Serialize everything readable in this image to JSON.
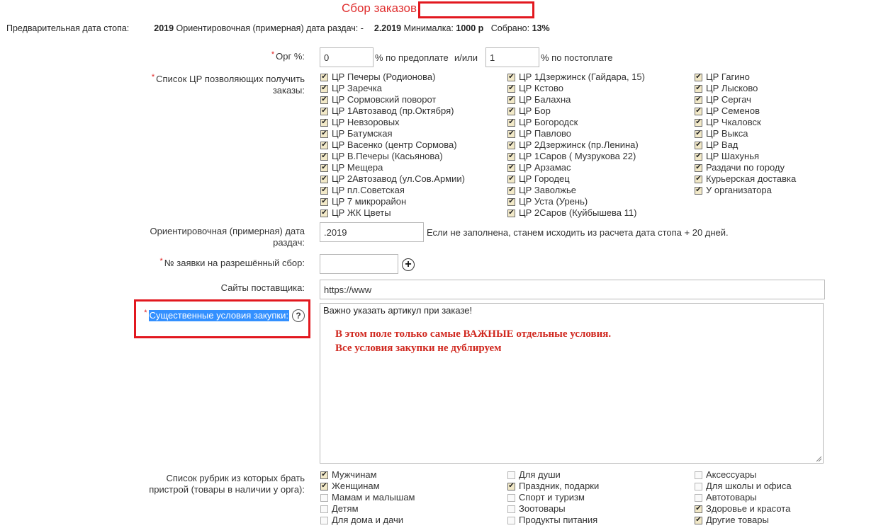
{
  "header": {
    "title": "Сбор заказов"
  },
  "summary": {
    "stop_label": "Предварительная дата стопа:",
    "stop_value": "2019",
    "dist_label": "Ориентировочная (примерная) дата раздач:",
    "dist_sep": "-",
    "dist_value": "2.2019",
    "min_label": "Минималка:",
    "min_value": "1000 р",
    "collected_label": "Собрано:",
    "collected_value": "13%"
  },
  "org": {
    "label": "Орг %:",
    "prepay_value": "0",
    "prepay_suffix": "% по предоплате",
    "or": "и/или",
    "postpay_value": "1",
    "postpay_suffix": "% по постоплате"
  },
  "centers": {
    "label": "Список ЦР позволяющих получить заказы:",
    "col1": [
      {
        "label": "ЦР Печеры (Родионова)",
        "checked": true
      },
      {
        "label": "ЦР Заречка",
        "checked": true
      },
      {
        "label": "ЦР Сормовский поворот",
        "checked": true
      },
      {
        "label": "ЦР 1Автозавод (пр.Октября)",
        "checked": true
      },
      {
        "label": "ЦР Невзоровых",
        "checked": true
      },
      {
        "label": "ЦР Батумская",
        "checked": true
      },
      {
        "label": "ЦР Васенко (центр Сормова)",
        "checked": true
      },
      {
        "label": "ЦР В.Печеры (Касьянова)",
        "checked": true
      },
      {
        "label": "ЦР Мещера",
        "checked": true
      },
      {
        "label": "ЦР 2Автозавод (ул.Сов.Армии)",
        "checked": true
      },
      {
        "label": "ЦР пл.Советская",
        "checked": true
      },
      {
        "label": "ЦР 7 микрорайон",
        "checked": true
      },
      {
        "label": "ЦР ЖК Цветы",
        "checked": true
      }
    ],
    "col2": [
      {
        "label": "ЦР 1Дзержинск (Гайдара, 15)",
        "checked": true
      },
      {
        "label": "ЦР Кстово",
        "checked": true
      },
      {
        "label": "ЦР Балахна",
        "checked": true
      },
      {
        "label": "ЦР Бор",
        "checked": true
      },
      {
        "label": "ЦР Богородск",
        "checked": true
      },
      {
        "label": "ЦР Павлово",
        "checked": true
      },
      {
        "label": "ЦР 2Дзержинск (пр.Ленина)",
        "checked": true
      },
      {
        "label": "ЦР 1Саров ( Музрукова 22)",
        "checked": true
      },
      {
        "label": "ЦР Арзамас",
        "checked": true
      },
      {
        "label": "ЦР Городец",
        "checked": true
      },
      {
        "label": "ЦР Заволжье",
        "checked": true
      },
      {
        "label": "ЦР Уста (Урень)",
        "checked": true
      },
      {
        "label": "ЦР 2Саров (Куйбышева 11)",
        "checked": true
      }
    ],
    "col3": [
      {
        "label": "ЦР Гагино",
        "checked": true
      },
      {
        "label": "ЦР Лысково",
        "checked": true
      },
      {
        "label": "ЦР Сергач",
        "checked": true
      },
      {
        "label": "ЦР Семенов",
        "checked": true
      },
      {
        "label": "ЦР Чкаловск",
        "checked": true
      },
      {
        "label": "ЦР Выкса",
        "checked": true
      },
      {
        "label": "ЦР Вад",
        "checked": true
      },
      {
        "label": "ЦР Шахунья",
        "checked": true
      },
      {
        "label": "Раздачи по городу",
        "checked": true
      },
      {
        "label": "Курьерская доставка",
        "checked": true
      },
      {
        "label": "У организатора",
        "checked": true
      }
    ]
  },
  "dist_date": {
    "label": "Ориентировочная (примерная) дата раздач:",
    "value": ".2019",
    "hint": "Если не заполнена, станем исходить из расчета дата стопа + 20 дней."
  },
  "permit": {
    "label": "№ заявки на разрешённый сбор:",
    "value": ""
  },
  "sites": {
    "label": "Сайты поставщика:",
    "value": "https://www"
  },
  "conditions": {
    "label": "Существенные условия закупки:",
    "help": "?",
    "value": "Важно указать артикул при заказе!",
    "note_line1": "В этом поле только самые ВАЖНЫЕ отдельные условия.",
    "note_line2": "Все условия закупки не дублируем"
  },
  "rubrics": {
    "label": "Список рубрик из которых брать пристрой (товары в наличии у орга):",
    "col1": [
      {
        "label": "Мужчинам",
        "checked": true
      },
      {
        "label": "Женщинам",
        "checked": true
      },
      {
        "label": "Мамам и малышам",
        "checked": false
      },
      {
        "label": "Детям",
        "checked": false
      },
      {
        "label": "Для дома и дачи",
        "checked": false
      }
    ],
    "col2": [
      {
        "label": "Для души",
        "checked": false
      },
      {
        "label": "Праздник, подарки",
        "checked": true
      },
      {
        "label": "Спорт и туризм",
        "checked": false
      },
      {
        "label": "Зоотовары",
        "checked": false
      },
      {
        "label": "Продукты питания",
        "checked": false
      }
    ],
    "col3": [
      {
        "label": "Аксессуары",
        "checked": false
      },
      {
        "label": "Для школы и офиса",
        "checked": false
      },
      {
        "label": "Автотовары",
        "checked": false
      },
      {
        "label": "Здоровье и красота",
        "checked": true
      },
      {
        "label": "Другие товары",
        "checked": true
      }
    ]
  },
  "colors": {
    "accent_red": "#e2181f",
    "title_red": "#e03030",
    "selection": "#3390ff"
  }
}
